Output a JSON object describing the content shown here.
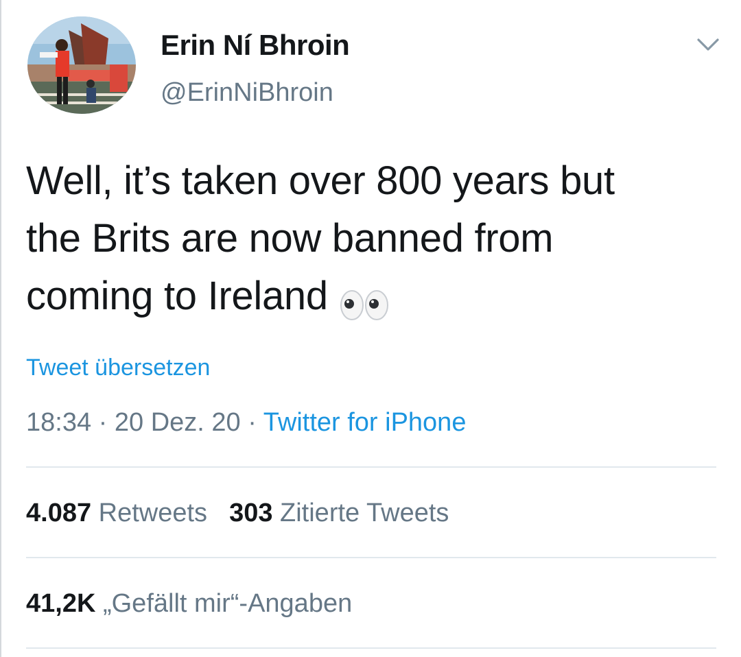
{
  "author": {
    "display_name": "Erin Ní Bhroin",
    "handle": "@ErinNiBhroin"
  },
  "tweet": {
    "text_lines": [
      "Well, it’s taken over 800 years but",
      "the Brits are now banned from",
      "coming to Ireland"
    ],
    "emoji": "eyes-emoji",
    "translate_label": "Tweet übersetzen",
    "time": "18:34",
    "date": "20 Dez. 20",
    "separator": " · ",
    "source": "Twitter for iPhone"
  },
  "stats": {
    "retweets_count": "4.087",
    "retweets_label": "Retweets",
    "quotes_count": "303",
    "quotes_label": "Zitierte Tweets",
    "likes_count": "41,2K",
    "likes_label": "„Gefällt mir“-Angaben"
  },
  "icons": {
    "more_menu": "chevron-down-icon"
  },
  "colors": {
    "text": "#14171a",
    "secondary": "#657786",
    "link": "#1b95e0",
    "divider": "#e1e8ed"
  }
}
